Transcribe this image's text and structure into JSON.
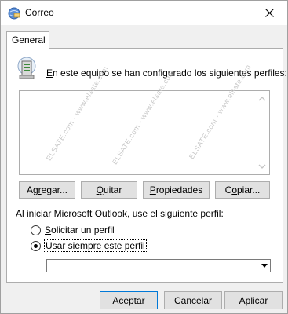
{
  "window": {
    "title": "Correo"
  },
  "tabs": [
    {
      "label": "General",
      "active": true
    }
  ],
  "profiles": {
    "label": "En este equipo se han configurado los siguientes perfiles:",
    "label_mnemonic": "E",
    "label_rest": "n este equipo se han configurado los siguientes perfiles:",
    "items": []
  },
  "watermarks": [
    "ELSATE.com - www.elsate.com",
    "ELSATE.com - www.elsate.com",
    "ELSATE.com - www.elsate.com"
  ],
  "profile_buttons": {
    "add": {
      "mn_pre": "Ag",
      "mn": "r",
      "mn_post": "egar..."
    },
    "remove": {
      "mn_pre": "",
      "mn": "Q",
      "mn_post": "uitar"
    },
    "properties": {
      "mn_pre": "",
      "mn": "P",
      "mn_post": "ropiedades"
    },
    "copy": {
      "mn_pre": "C",
      "mn": "o",
      "mn_post": "piar..."
    }
  },
  "startup": {
    "label": "Al iniciar Microsoft Outlook, use el siguiente perfil:",
    "options": [
      {
        "mn": "S",
        "rest": "olicitar un perfil",
        "checked": false
      },
      {
        "mn": "U",
        "rest": "sar siempre este perfil",
        "checked": true
      }
    ],
    "selected_profile": ""
  },
  "footer": {
    "ok": "Aceptar",
    "cancel": "Cancelar",
    "apply_pre": "Apl",
    "apply_mn": "i",
    "apply_post": "car"
  },
  "colors": {
    "window_bg": "#f0f0f0",
    "button_bg": "#e1e1e1",
    "border": "#adadad"
  }
}
